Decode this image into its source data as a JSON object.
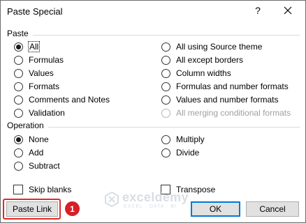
{
  "dialog": {
    "title": "Paste Special",
    "help_glyph": "?"
  },
  "paste": {
    "label": "Paste",
    "left_options": [
      {
        "label": "All",
        "checked": true
      },
      {
        "label": "Formulas"
      },
      {
        "label": "Values"
      },
      {
        "label": "Formats"
      },
      {
        "label": "Comments and Notes"
      },
      {
        "label": "Validation"
      }
    ],
    "right_options": [
      {
        "label": "All using Source theme"
      },
      {
        "label": "All except borders"
      },
      {
        "label": "Column widths"
      },
      {
        "label": "Formulas and number formats"
      },
      {
        "label": "Values and number formats"
      },
      {
        "label": "All merging conditional formats",
        "disabled": true
      }
    ]
  },
  "operation": {
    "label": "Operation",
    "left_options": [
      {
        "label": "None",
        "checked": true
      },
      {
        "label": "Add"
      },
      {
        "label": "Subtract"
      }
    ],
    "right_options": [
      {
        "label": "Multiply"
      },
      {
        "label": "Divide"
      }
    ]
  },
  "checkboxes": {
    "skip_blanks": "Skip blanks",
    "transpose": "Transpose"
  },
  "buttons": {
    "paste_link": "Paste Link",
    "ok": "OK",
    "cancel": "Cancel"
  },
  "annotation": {
    "step": "1"
  },
  "watermark": {
    "name": "exceldemy",
    "tagline": "EXCEL · DATA · BI"
  },
  "colors": {
    "default_button_border": "#0078d7",
    "annotation_red": "#d71f26"
  }
}
